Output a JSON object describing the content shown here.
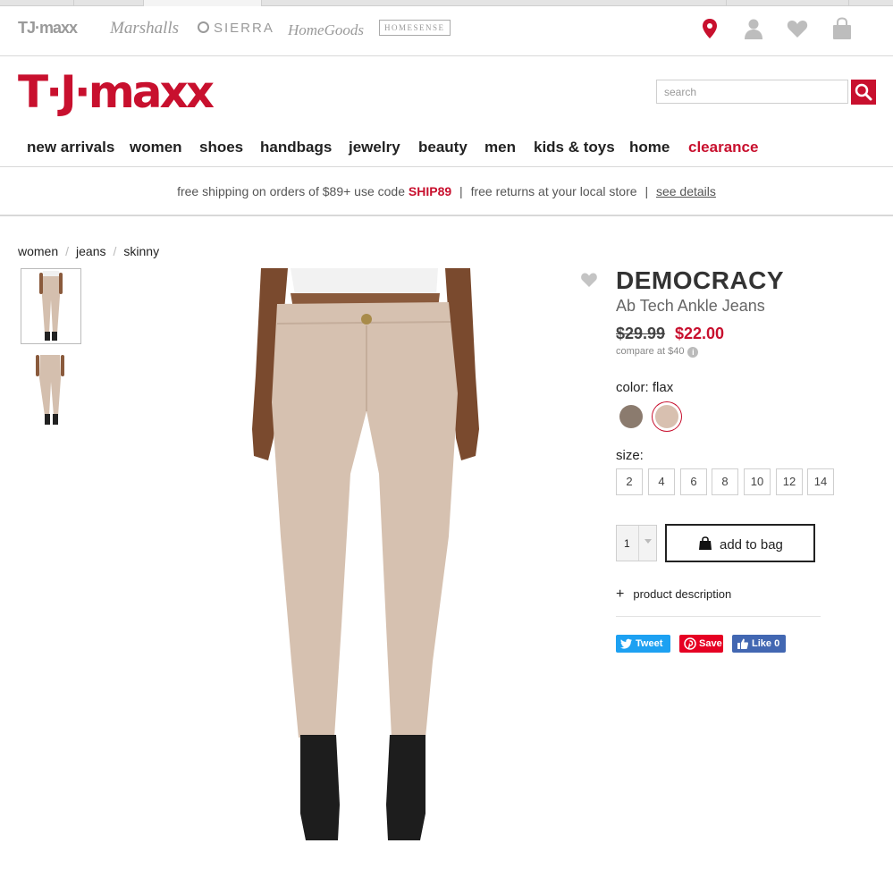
{
  "brand_bar": {
    "brands": [
      "TJ·maxx",
      "Marshalls",
      "SIERRA",
      "HomeGoods",
      "HOMESENSE"
    ],
    "icons": [
      "location-pin-icon",
      "account-icon",
      "wishlist-heart-icon",
      "shopping-bag-icon"
    ]
  },
  "header": {
    "logo": "T·J·maxx",
    "search_placeholder": "search"
  },
  "nav": {
    "items": [
      "new arrivals",
      "women",
      "shoes",
      "handbags",
      "jewelry",
      "beauty",
      "men",
      "kids & toys",
      "home",
      "clearance"
    ]
  },
  "promo": {
    "text1": "free shipping on orders of $89+ use code",
    "code": "SHIP89",
    "text2": "free returns at your local store",
    "link": "see details"
  },
  "breadcrumb": [
    "women",
    "jeans",
    "skinny"
  ],
  "product": {
    "brand": "DEMOCRACY",
    "title": "Ab Tech Ankle Jeans",
    "price_old": "$29.99",
    "price_new": "$22.00",
    "compare": "compare at  $40",
    "color_label": "color:",
    "color_value": "flax",
    "swatches": [
      "#8b7b6e",
      "#d8c0b0"
    ],
    "size_label": "size:",
    "sizes": [
      "2",
      "4",
      "6",
      "8",
      "10",
      "12",
      "14"
    ],
    "quantity": "1",
    "add_to_bag": "add to bag",
    "description_toggle": "product description"
  },
  "share": {
    "tweet": "Tweet",
    "save": "Save",
    "like": "Like 0"
  },
  "colors": {
    "brand_red": "#c8102e",
    "twitter": "#1da1f2",
    "pinterest": "#e60023",
    "facebook": "#4267b2"
  }
}
